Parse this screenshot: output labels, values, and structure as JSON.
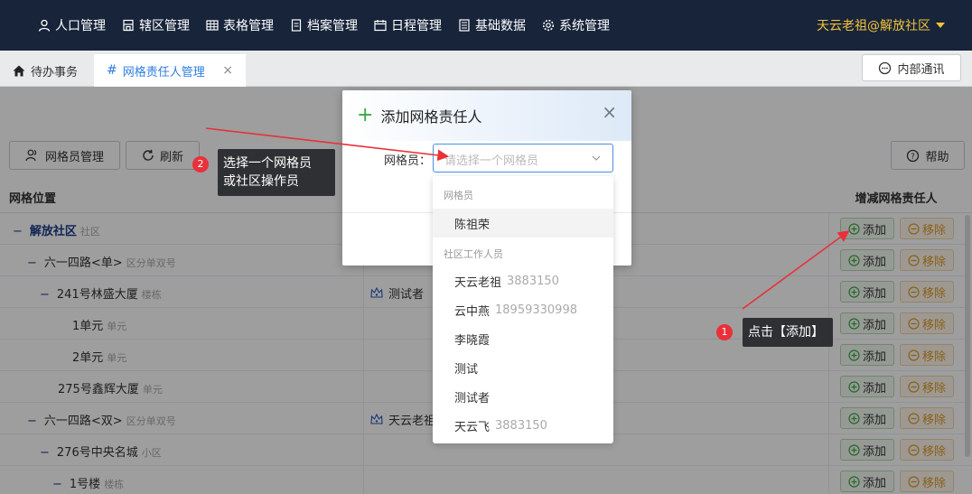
{
  "nav": {
    "items": [
      {
        "label": "人口管理",
        "icon": "person-icon"
      },
      {
        "label": "辖区管理",
        "icon": "building-icon"
      },
      {
        "label": "表格管理",
        "icon": "table-icon"
      },
      {
        "label": "档案管理",
        "icon": "file-icon"
      },
      {
        "label": "日程管理",
        "icon": "calendar-icon"
      },
      {
        "label": "基础数据",
        "icon": "database-icon"
      },
      {
        "label": "系统管理",
        "icon": "gear-icon"
      }
    ],
    "user": "天云老祖@解放社区"
  },
  "tabs": {
    "home": "待办事务",
    "active": "网格责任人管理",
    "close": "×"
  },
  "inner_msg": "内部通讯",
  "toolbar": {
    "grid_member_btn": "网格员管理",
    "refresh_btn": "刷新",
    "help_btn": "帮助"
  },
  "table": {
    "col_location": "网格位置",
    "col_ops": "增减网格责任人",
    "add_label": "添加",
    "remove_label": "移除",
    "rows": [
      {
        "toggle": "−",
        "name": "解放社区",
        "type": "社区",
        "owner": ""
      },
      {
        "toggle": "−",
        "name": "六一四路<单>",
        "type": "区分单双号",
        "owner": ""
      },
      {
        "toggle": "−",
        "name": "241号林盛大厦",
        "type": "楼栋",
        "owner": "测试者"
      },
      {
        "toggle": "",
        "name": "1单元",
        "type": "单元",
        "owner": ""
      },
      {
        "toggle": "",
        "name": "2单元",
        "type": "单元",
        "owner": ""
      },
      {
        "toggle": "",
        "name": "275号鑫辉大厦",
        "type": "单元",
        "owner": ""
      },
      {
        "toggle": "−",
        "name": "六一四路<双>",
        "type": "区分单双号",
        "owner": "天云老祖"
      },
      {
        "toggle": "−",
        "name": "276号中央名城",
        "type": "小区",
        "owner": ""
      },
      {
        "toggle": "−",
        "name": "1号楼",
        "type": "楼栋",
        "owner": ""
      }
    ]
  },
  "modal": {
    "title": "添加网格责任人",
    "field_label": "网格员：",
    "placeholder": "请选择一个网格员"
  },
  "dropdown": {
    "group1": "网格员",
    "group2": "社区工作人员",
    "items": [
      {
        "name": "陈祖荣",
        "phone": ""
      },
      {
        "name": "天云老祖",
        "phone": "3883150"
      },
      {
        "name": "云中燕",
        "phone": "18959330998"
      },
      {
        "name": "李晓霞",
        "phone": ""
      },
      {
        "name": "测试",
        "phone": ""
      },
      {
        "name": "测试者",
        "phone": ""
      },
      {
        "name": "天云飞",
        "phone": "3883150"
      }
    ]
  },
  "annotations": {
    "step1_num": "1",
    "step1_text": "点击【添加】",
    "step2_num": "2",
    "step2_line1": "选择一个网格员",
    "step2_line2": "或社区操作员"
  },
  "colors": {
    "nav_bg": "#17243a",
    "accent": "#2d7de0",
    "user_gold": "#f2c23a",
    "badge_red": "#e8313a",
    "arrow_red": "#e8313a"
  }
}
